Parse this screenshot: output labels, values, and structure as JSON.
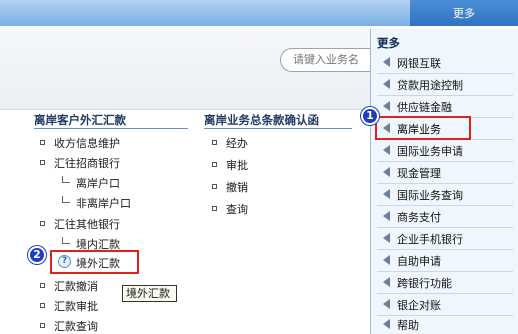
{
  "topbar": {
    "more_label": "更多"
  },
  "search": {
    "placeholder": "请键入业务名"
  },
  "left_section": {
    "title": "离岸客户外汇汇款",
    "items": [
      {
        "label": "收方信息维护"
      },
      {
        "label": "汇往招商银行"
      },
      {
        "label": "离岸户口"
      },
      {
        "label": "非离岸户口"
      },
      {
        "label": "汇往其他银行"
      },
      {
        "label": "境内汇款"
      },
      {
        "label": "境外汇款"
      },
      {
        "label": "汇款撤消"
      },
      {
        "label": "汇款审批"
      },
      {
        "label": "汇款查询"
      }
    ],
    "tooltip": "境外汇款"
  },
  "right_section": {
    "title": "离岸业务总条款确认函",
    "items": [
      {
        "label": "经办"
      },
      {
        "label": "审批"
      },
      {
        "label": "撤销"
      },
      {
        "label": "查询"
      }
    ]
  },
  "badges": {
    "one": "1",
    "two": "2"
  },
  "menu": {
    "title": "更多",
    "items": [
      {
        "label": "网银互联"
      },
      {
        "label": "贷款用途控制"
      },
      {
        "label": "供应链金融"
      },
      {
        "label": "离岸业务"
      },
      {
        "label": "国际业务申请"
      },
      {
        "label": "现金管理"
      },
      {
        "label": "国际业务查询"
      },
      {
        "label": "商务支付"
      },
      {
        "label": "企业手机银行"
      },
      {
        "label": "自助申请"
      },
      {
        "label": "跨银行功能"
      },
      {
        "label": "银企对账"
      },
      {
        "label": "帮助"
      }
    ]
  },
  "colors": {
    "highlight": "#e0211f",
    "badge": "#1d3fbf",
    "accent": "#2f73c2"
  }
}
